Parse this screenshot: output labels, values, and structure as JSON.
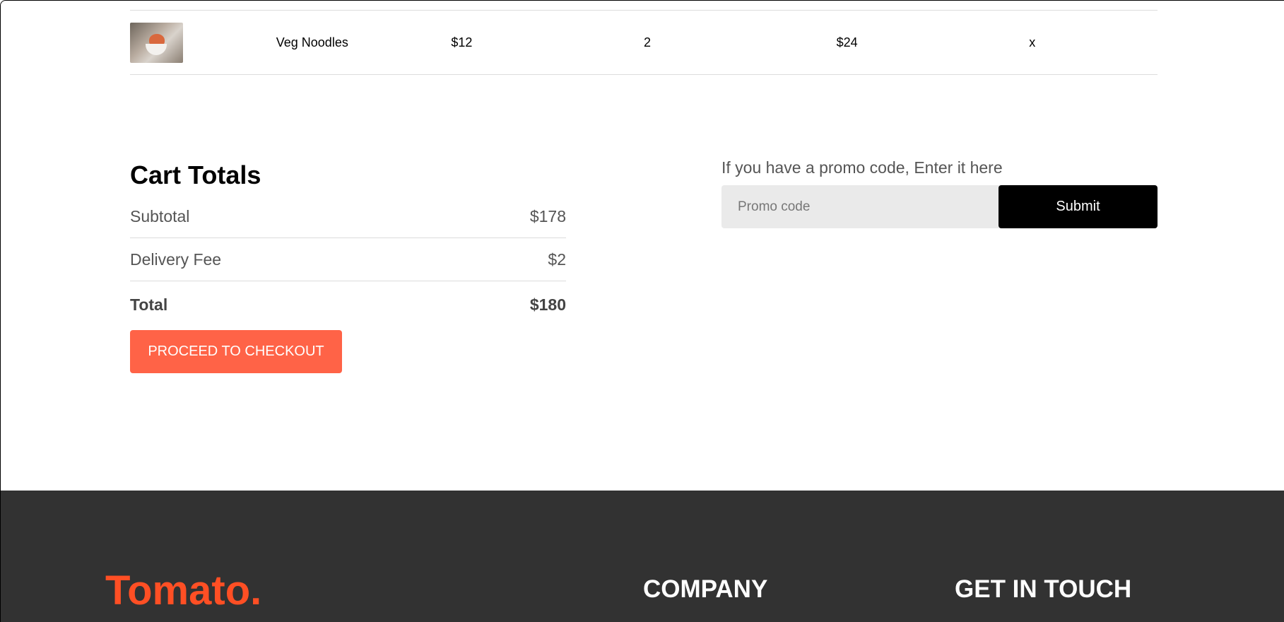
{
  "cart": {
    "row": {
      "name": "Veg Noodles",
      "price": "$12",
      "quantity": "2",
      "total": "$24",
      "remove": "x"
    }
  },
  "totals": {
    "title": "Cart Totals",
    "subtotal_label": "Subtotal",
    "subtotal_value": "$178",
    "delivery_label": "Delivery Fee",
    "delivery_value": "$2",
    "total_label": "Total",
    "total_value": "$180",
    "checkout_label": "PROCEED TO CHECKOUT"
  },
  "promo": {
    "prompt": "If you have a promo code, Enter it here",
    "placeholder": "Promo code",
    "submit_label": "Submit"
  },
  "footer": {
    "logo": "Tomato.",
    "company_heading": "COMPANY",
    "touch_heading": "GET IN TOUCH"
  },
  "colors": {
    "accent": "#ff6347",
    "logo": "#ff4f24",
    "footer_bg": "#323232"
  }
}
